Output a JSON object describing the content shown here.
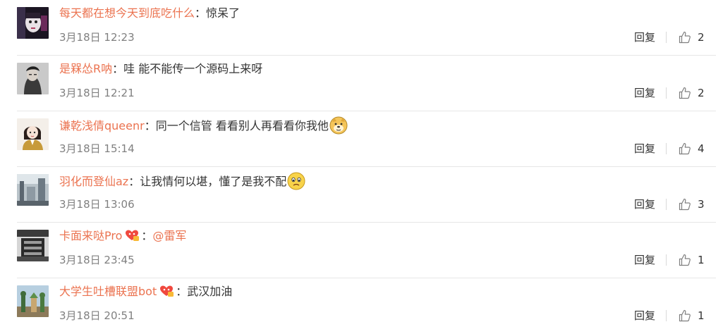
{
  "reply_label": "回复",
  "comments": [
    {
      "user": "每天都在想今天到底吃什么",
      "text": "惊呆了",
      "time": "3月18日 12:23",
      "likes": "2"
    },
    {
      "user": "是槑怂R呐",
      "text": "哇 能不能传一个源码上来呀",
      "time": "3月18日 12:21",
      "likes": "2"
    },
    {
      "user": "谦乾浅倩queenr",
      "text": "同一个信管 看看别人再看看你我他",
      "time": "3月18日 15:14",
      "likes": "4"
    },
    {
      "user": "羽化而登仙az",
      "text": "让我情何以堪，懂了是我不配",
      "time": "3月18日 13:06",
      "likes": "3"
    },
    {
      "user": "卡面来哒Pro",
      "text": "@雷军",
      "time": "3月18日 23:45",
      "likes": "1"
    },
    {
      "user": "大学生吐槽联盟bot",
      "text": "武汉加油",
      "time": "3月18日 20:51",
      "likes": "1"
    }
  ]
}
